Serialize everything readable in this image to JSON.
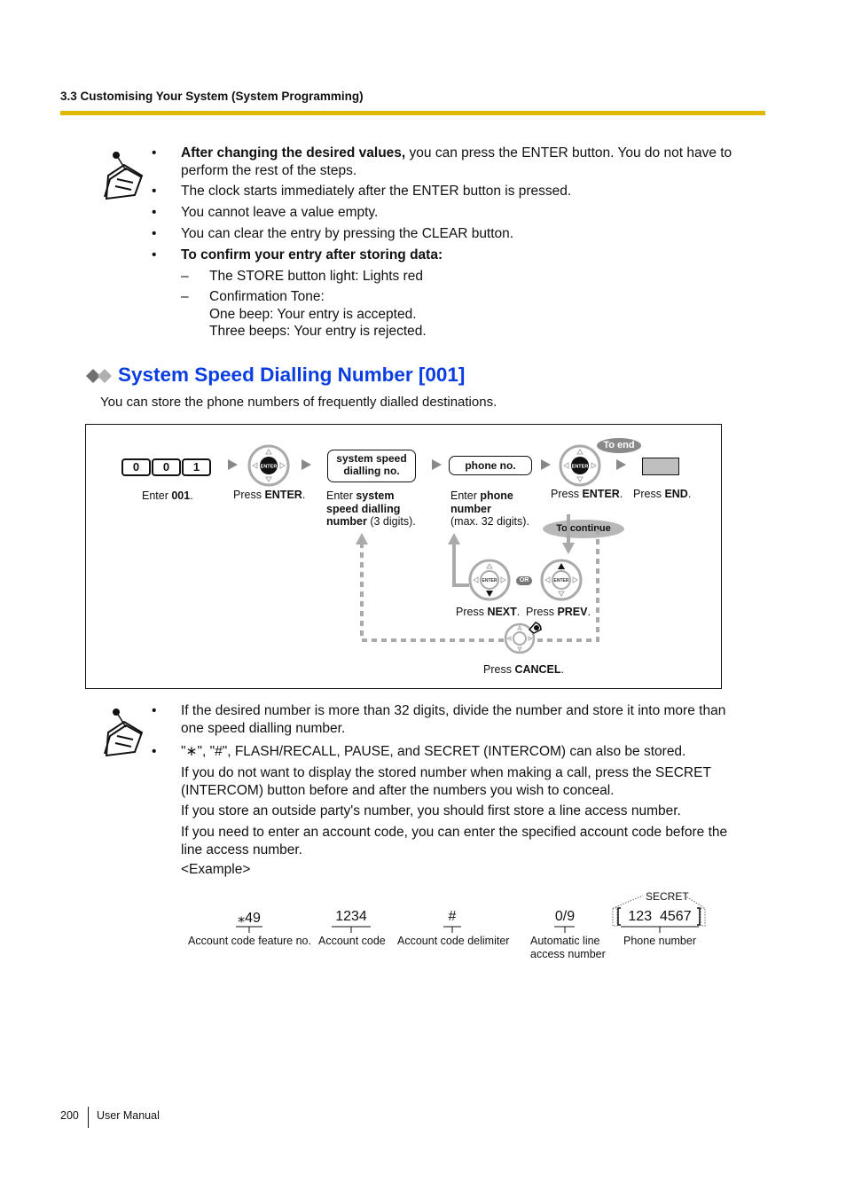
{
  "header": {
    "section": "3.3 Customising Your System (System Programming)",
    "rule_color": "#dfb800"
  },
  "notes_top": {
    "icon": "note-pin-icon",
    "items": [
      {
        "type": "bullet",
        "bold": "After changing the desired values,",
        "text": " you can press the ENTER button. You do not have to",
        "line2": "perform the rest of the steps."
      },
      {
        "type": "bullet",
        "bold": "",
        "text": "The clock starts immediately after the ENTER button is pressed."
      },
      {
        "type": "bullet",
        "bold": "",
        "text": "You cannot leave a value empty."
      },
      {
        "type": "bullet",
        "bold": "",
        "text": "You can clear the entry by pressing the CLEAR button."
      },
      {
        "type": "bullet",
        "bold": "To confirm your entry after storing data:",
        "text": ""
      },
      {
        "type": "dash",
        "text": "The STORE button light: Lights red"
      },
      {
        "type": "dash",
        "text": "Confirmation Tone:",
        "line2": "One beep: Your entry is accepted.",
        "line3": "Three beeps: Your entry is rejected."
      }
    ]
  },
  "section": {
    "title": "System Speed Dialling Number [001]",
    "title_color": "#0a3ee0",
    "intro": "You can store the phone numbers of frequently dialled destinations."
  },
  "diagram": {
    "keys": [
      "0",
      "0",
      "1"
    ],
    "step1": {
      "pre": "Enter ",
      "bold": "001",
      "post": "."
    },
    "step2": {
      "pre": "Press ",
      "bold": "ENTER",
      "post": "."
    },
    "box1": {
      "line1": "system speed",
      "line2": "dialling no."
    },
    "step3": {
      "pre": "Enter ",
      "bold1": "system",
      "bold2": "speed dialling",
      "bold3": "number",
      "post": " (3 digits)."
    },
    "box2": "phone no.",
    "step4": {
      "pre": "Enter ",
      "bold1": "phone",
      "bold2": "number",
      "post": "(max. 32 digits)."
    },
    "step5": {
      "pre": "Press ",
      "bold": "ENTER",
      "post": "."
    },
    "step6": {
      "pre": "Press ",
      "bold": "END",
      "post": "."
    },
    "to_end": "To end",
    "to_continue": "To continue",
    "enter_label": "ENTER",
    "or_label": "OR",
    "next": {
      "pre": "Press ",
      "bold": "NEXT",
      "post": "."
    },
    "prev": {
      "pre": "Press ",
      "bold": "PREV",
      "post": "."
    },
    "cancel": {
      "pre": "Press ",
      "bold": "CANCEL",
      "post": "."
    }
  },
  "notes_bottom": {
    "icon": "note-pin-icon",
    "items": [
      {
        "line1": "If the desired number is more than 32 digits, divide the number and store it into more than",
        "line2": "one speed dialling number."
      },
      {
        "line1": "\"∗\", \"#\", FLASH/RECALL, PAUSE, and SECRET (INTERCOM) can also be stored."
      }
    ],
    "paragraphs": [
      {
        "line1": "If you do not want to display the stored number when making a call, press the SECRET",
        "line2": "(INTERCOM) button before and after the numbers you wish to conceal."
      },
      {
        "line1": "If you store an outside party's number, you should first store a line access number."
      },
      {
        "line1": "If you need to enter an account code, you can enter the specified account code before the",
        "line2": "line access number."
      },
      {
        "line1": "<Example>"
      }
    ]
  },
  "example": {
    "secret_label": "SECRET",
    "parts": [
      {
        "value": "‶49",
        "label": "Account code feature no."
      },
      {
        "value": "1234",
        "label": "Account code"
      },
      {
        "value": "#",
        "label": "Account code delimiter"
      },
      {
        "value": "0/9",
        "label": "Automatic line",
        "label2": "access number"
      },
      {
        "value": "123  4567",
        "label": "Phone number"
      }
    ]
  },
  "footer": {
    "page": "200",
    "title": "User Manual"
  }
}
